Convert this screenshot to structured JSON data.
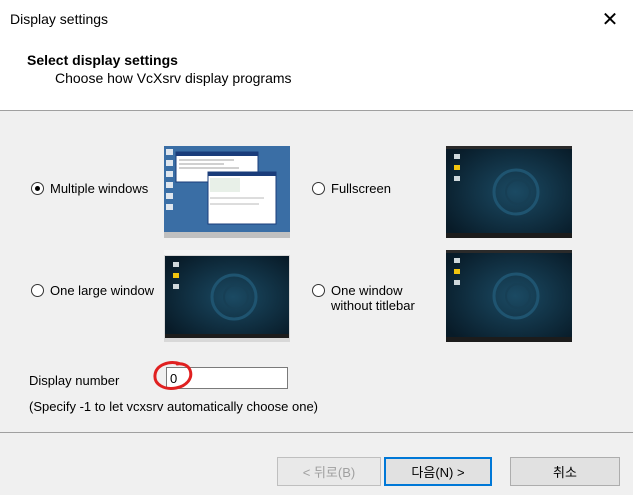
{
  "window": {
    "title": "Display settings"
  },
  "header": {
    "title": "Select display settings",
    "subtitle": "Choose how VcXsrv display programs"
  },
  "options": [
    {
      "label": "Multiple windows",
      "checked": true
    },
    {
      "label": "Fullscreen",
      "checked": false
    },
    {
      "label": "One large window",
      "checked": false
    },
    {
      "label_line1": "One window",
      "label_line2": "without titlebar",
      "checked": false
    }
  ],
  "display_number": {
    "label": "Display number",
    "value": "0"
  },
  "hint": "(Specify -1 to let vcxsrv automatically choose one)",
  "buttons": {
    "back": "< 뒤로(B)",
    "next": "다음(N) >",
    "cancel": "취소"
  },
  "icons": {
    "close": "close-icon"
  },
  "colors": {
    "accent": "#0078d7",
    "annotation": "#e02020",
    "desktop": "#0e2a3c",
    "classic_desktop": "#3a6ea5"
  }
}
